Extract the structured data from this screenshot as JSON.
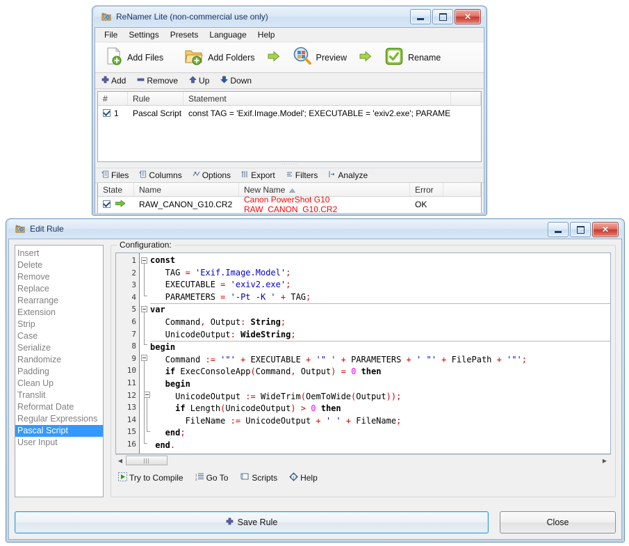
{
  "main_window": {
    "title": "ReNamer Lite (non-commercial use only)",
    "icon": "app-icon",
    "controls": {
      "minimize": "minimize",
      "maximize": "maximize",
      "close": "close"
    },
    "menu": [
      "File",
      "Settings",
      "Presets",
      "Language",
      "Help"
    ],
    "toolbar": [
      {
        "label": "Add Files",
        "icon": "add-files-icon"
      },
      {
        "label": "Add Folders",
        "icon": "add-folders-icon"
      },
      {
        "label": "Preview",
        "icon": "preview-icon"
      },
      {
        "label": "Rename",
        "icon": "rename-icon"
      }
    ],
    "rule_toolbar": [
      {
        "label": "Add",
        "icon": "plus-icon"
      },
      {
        "label": "Remove",
        "icon": "minus-icon"
      },
      {
        "label": "Up",
        "icon": "arrow-up-icon"
      },
      {
        "label": "Down",
        "icon": "arrow-down-icon"
      }
    ],
    "rules_grid": {
      "columns": [
        "#",
        "Rule",
        "Statement",
        ""
      ],
      "rows": [
        {
          "checked": true,
          "num": "1",
          "rule": "Pascal Script",
          "statement": "const TAG = 'Exif.Image.Model'; EXECUTABLE = 'exiv2.exe'; PARAME..."
        }
      ]
    },
    "files_toolbar": [
      {
        "label": "Files",
        "icon": "files-icon"
      },
      {
        "label": "Columns",
        "icon": "columns-icon"
      },
      {
        "label": "Options",
        "icon": "options-icon"
      },
      {
        "label": "Export",
        "icon": "export-icon"
      },
      {
        "label": "Filters",
        "icon": "filters-icon"
      },
      {
        "label": "Analyze",
        "icon": "analyze-icon"
      }
    ],
    "files_grid": {
      "columns": [
        "State",
        "Name",
        "New Name",
        "Error",
        ""
      ],
      "sort_column": "New Name",
      "sort_dir": "ascending",
      "rows": [
        {
          "checked": true,
          "state_icon": "green-arrow-icon",
          "name": "RAW_CANON_G10.CR2",
          "new_name": "Canon PowerShot G10 RAW_CANON_G10.CR2",
          "new_name_color": "#ff0000",
          "error": "OK"
        }
      ]
    }
  },
  "edit_rule": {
    "title": "Edit Rule",
    "icon": "app-icon",
    "controls": {
      "minimize": "minimize",
      "maximize": "maximize",
      "close": "close"
    },
    "rule_types": [
      "Insert",
      "Delete",
      "Remove",
      "Replace",
      "Rearrange",
      "Extension",
      "Strip",
      "Case",
      "Serialize",
      "Randomize",
      "Padding",
      "Clean Up",
      "Translit",
      "Reformat Date",
      "Regular Expressions",
      "Pascal Script",
      "User Input"
    ],
    "selected_rule_type": "Pascal Script",
    "selected_index": 15,
    "configuration_legend": "Configuration:",
    "code_lines": [
      {
        "n": "1",
        "tokens": [
          {
            "t": "const",
            "c": "k"
          }
        ]
      },
      {
        "n": "2",
        "tokens": [
          {
            "t": "   TAG ",
            "c": "pl"
          },
          {
            "t": "=",
            "c": "p"
          },
          {
            "t": " ",
            "c": "pl"
          },
          {
            "t": "'Exif.Image.Model'",
            "c": "s"
          },
          {
            "t": ";",
            "c": "p"
          }
        ]
      },
      {
        "n": "3",
        "tokens": [
          {
            "t": "   EXECUTABLE ",
            "c": "pl"
          },
          {
            "t": "=",
            "c": "p"
          },
          {
            "t": " ",
            "c": "pl"
          },
          {
            "t": "'exiv2.exe'",
            "c": "s"
          },
          {
            "t": ";",
            "c": "p"
          }
        ]
      },
      {
        "n": "4",
        "tokens": [
          {
            "t": "   PARAMETERS ",
            "c": "pl"
          },
          {
            "t": "=",
            "c": "p"
          },
          {
            "t": " ",
            "c": "pl"
          },
          {
            "t": "'-Pt -K '",
            "c": "s"
          },
          {
            "t": " + ",
            "c": "p"
          },
          {
            "t": "TAG",
            "c": "pl"
          },
          {
            "t": ";",
            "c": "p"
          }
        ]
      },
      {
        "n": "5",
        "tokens": [
          {
            "t": "var",
            "c": "k"
          }
        ]
      },
      {
        "n": "6",
        "tokens": [
          {
            "t": "   Command",
            "c": "pl"
          },
          {
            "t": ",",
            "c": "p"
          },
          {
            "t": " Output",
            "c": "pl"
          },
          {
            "t": ":",
            "c": "p"
          },
          {
            "t": " ",
            "c": "pl"
          },
          {
            "t": "String",
            "c": "k"
          },
          {
            "t": ";",
            "c": "p"
          }
        ]
      },
      {
        "n": "7",
        "tokens": [
          {
            "t": "   UnicodeOutput",
            "c": "pl"
          },
          {
            "t": ":",
            "c": "p"
          },
          {
            "t": " ",
            "c": "pl"
          },
          {
            "t": "WideString",
            "c": "k"
          },
          {
            "t": ";",
            "c": "p"
          }
        ]
      },
      {
        "n": "8",
        "tokens": [
          {
            "t": "begin",
            "c": "k"
          }
        ]
      },
      {
        "n": "9",
        "tokens": [
          {
            "t": "   Command ",
            "c": "pl"
          },
          {
            "t": ":=",
            "c": "p"
          },
          {
            "t": " ",
            "c": "pl"
          },
          {
            "t": "'\"'",
            "c": "s"
          },
          {
            "t": " + ",
            "c": "p"
          },
          {
            "t": "EXECUTABLE",
            "c": "pl"
          },
          {
            "t": " + ",
            "c": "p"
          },
          {
            "t": "'\" '",
            "c": "s"
          },
          {
            "t": " + ",
            "c": "p"
          },
          {
            "t": "PARAMETERS",
            "c": "pl"
          },
          {
            "t": " + ",
            "c": "p"
          },
          {
            "t": "' \"'",
            "c": "s"
          },
          {
            "t": " + ",
            "c": "p"
          },
          {
            "t": "FilePath",
            "c": "pl"
          },
          {
            "t": " + ",
            "c": "p"
          },
          {
            "t": "'\"'",
            "c": "s"
          },
          {
            "t": ";",
            "c": "p"
          }
        ]
      },
      {
        "n": "10",
        "tokens": [
          {
            "t": "   ",
            "c": "pl"
          },
          {
            "t": "if",
            "c": "k"
          },
          {
            "t": " ExecConsoleApp",
            "c": "pl"
          },
          {
            "t": "(",
            "c": "p"
          },
          {
            "t": "Command",
            "c": "pl"
          },
          {
            "t": ",",
            "c": "p"
          },
          {
            "t": " Output",
            "c": "pl"
          },
          {
            "t": ")",
            "c": "p"
          },
          {
            "t": " ",
            "c": "pl"
          },
          {
            "t": "=",
            "c": "p"
          },
          {
            "t": " ",
            "c": "pl"
          },
          {
            "t": "0",
            "c": "n"
          },
          {
            "t": " ",
            "c": "pl"
          },
          {
            "t": "then",
            "c": "k"
          }
        ]
      },
      {
        "n": "11",
        "tokens": [
          {
            "t": "   begin",
            "c": "k"
          }
        ]
      },
      {
        "n": "12",
        "tokens": [
          {
            "t": "     UnicodeOutput ",
            "c": "pl"
          },
          {
            "t": ":=",
            "c": "p"
          },
          {
            "t": " WideTrim",
            "c": "pl"
          },
          {
            "t": "(",
            "c": "p"
          },
          {
            "t": "OemToWide",
            "c": "pl"
          },
          {
            "t": "(",
            "c": "p"
          },
          {
            "t": "Output",
            "c": "pl"
          },
          {
            "t": "))",
            "c": "p"
          },
          {
            "t": ";",
            "c": "p"
          }
        ]
      },
      {
        "n": "13",
        "tokens": [
          {
            "t": "     ",
            "c": "pl"
          },
          {
            "t": "if",
            "c": "k"
          },
          {
            "t": " Length",
            "c": "pl"
          },
          {
            "t": "(",
            "c": "p"
          },
          {
            "t": "UnicodeOutput",
            "c": "pl"
          },
          {
            "t": ")",
            "c": "p"
          },
          {
            "t": " ",
            "c": "pl"
          },
          {
            "t": ">",
            "c": "p"
          },
          {
            "t": " ",
            "c": "pl"
          },
          {
            "t": "0",
            "c": "n"
          },
          {
            "t": " ",
            "c": "pl"
          },
          {
            "t": "then",
            "c": "k"
          }
        ]
      },
      {
        "n": "14",
        "tokens": [
          {
            "t": "       FileName ",
            "c": "pl"
          },
          {
            "t": ":=",
            "c": "p"
          },
          {
            "t": " UnicodeOutput",
            "c": "pl"
          },
          {
            "t": " + ",
            "c": "p"
          },
          {
            "t": "' '",
            "c": "s"
          },
          {
            "t": " + ",
            "c": "p"
          },
          {
            "t": "FileName",
            "c": "pl"
          },
          {
            "t": ";",
            "c": "p"
          }
        ]
      },
      {
        "n": "15",
        "tokens": [
          {
            "t": "   end",
            "c": "k"
          },
          {
            "t": ";",
            "c": "p"
          }
        ]
      },
      {
        "n": "16",
        "tokens": [
          {
            "t": " end",
            "c": "k"
          },
          {
            "t": ".",
            "c": "p"
          }
        ]
      }
    ],
    "editor_toolbar": [
      {
        "label": "Try to Compile",
        "icon": "compile-icon"
      },
      {
        "label": "Go To",
        "icon": "goto-icon"
      },
      {
        "label": "Scripts",
        "icon": "scripts-icon"
      },
      {
        "label": "Help",
        "icon": "help-icon"
      }
    ],
    "footer": {
      "save_label": "Save Rule",
      "save_icon": "plus-icon",
      "close_label": "Close"
    }
  },
  "colors": {
    "accent": "#3399ff",
    "error_text": "#ff0000",
    "string": "#0000cd",
    "punct": "#d00000",
    "number": "#ff00ff",
    "window_border": "#6a93b5"
  }
}
